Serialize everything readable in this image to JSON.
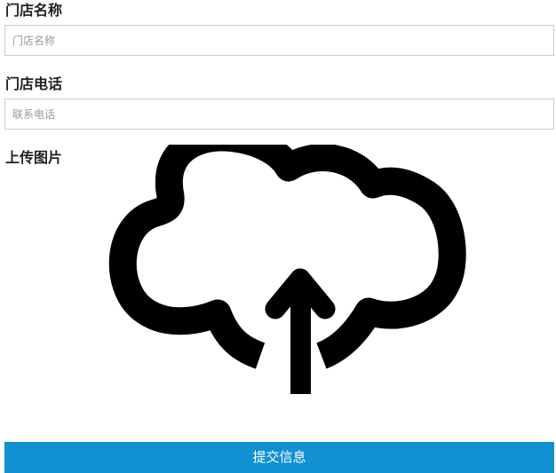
{
  "form": {
    "store_name": {
      "label": "门店名称",
      "placeholder": "门店名称",
      "value": ""
    },
    "store_phone": {
      "label": "门店电话",
      "placeholder": "联系电话",
      "value": ""
    },
    "upload": {
      "label": "上传图片",
      "icon": "cloud-upload-icon"
    },
    "submit_label": "提交信息"
  },
  "colors": {
    "accent": "#1190d2",
    "icon": "#000000",
    "input_border": "#cccccc",
    "label_text": "#222222"
  }
}
